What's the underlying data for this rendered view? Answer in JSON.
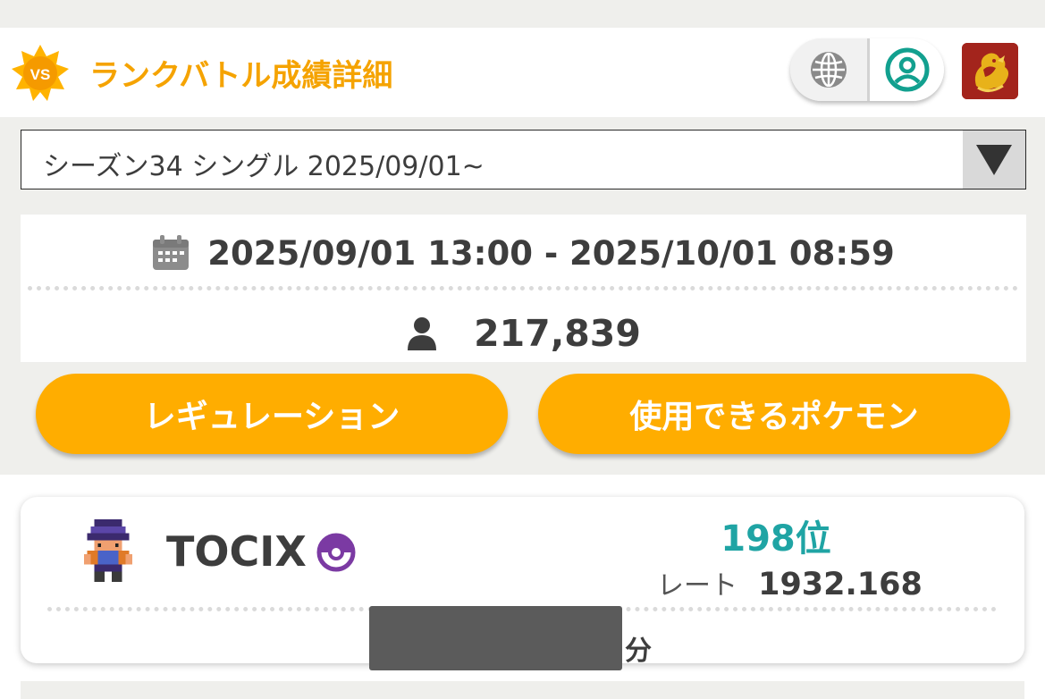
{
  "header": {
    "badge_text": "VS",
    "title": "ランクバトル成績詳細",
    "icons": {
      "globe": "globe-icon",
      "profile": "profile-icon",
      "trainer": "trainer-badge-icon"
    }
  },
  "season_select": {
    "selected": "シーズン34 シングル 2025/09/01~"
  },
  "season_info": {
    "period": "2025/09/01 13:00 - 2025/10/01 08:59",
    "players": "217,839",
    "icons": {
      "period": "calendar-icon",
      "players": "person-icon"
    }
  },
  "buttons": {
    "regulation": "レギュレーション",
    "usable_pokemon": "使用できるポケモン"
  },
  "record": {
    "player_name": "TOCIX",
    "rank": "198位",
    "rate_label": "レート",
    "rate_value": "1932.168",
    "minutes_unit": "分"
  },
  "colors": {
    "accent": "#ffad00",
    "title": "#f5a300",
    "rank": "#1fa4a4",
    "profile": "#12a08f",
    "ball": "#7b3aa3",
    "trainer_bg": "#a3241c"
  }
}
